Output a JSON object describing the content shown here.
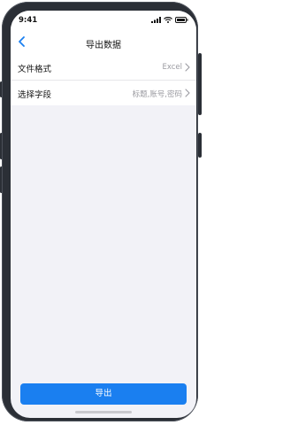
{
  "status_bar": {
    "time": "9:41",
    "icons": [
      "cellular-signal-icon",
      "wifi-icon",
      "battery-icon"
    ]
  },
  "nav": {
    "back_icon": "chevron-left-icon",
    "title": "导出数据"
  },
  "settings": [
    {
      "label": "文件格式",
      "value": "Excel"
    },
    {
      "label": "选择字段",
      "value": "标题,账号,密码"
    }
  ],
  "actions": {
    "export_label": "导出"
  },
  "colors": {
    "accent": "#1a7ff0",
    "background": "#f2f2f7",
    "secondary_text": "#9b9ba1"
  }
}
